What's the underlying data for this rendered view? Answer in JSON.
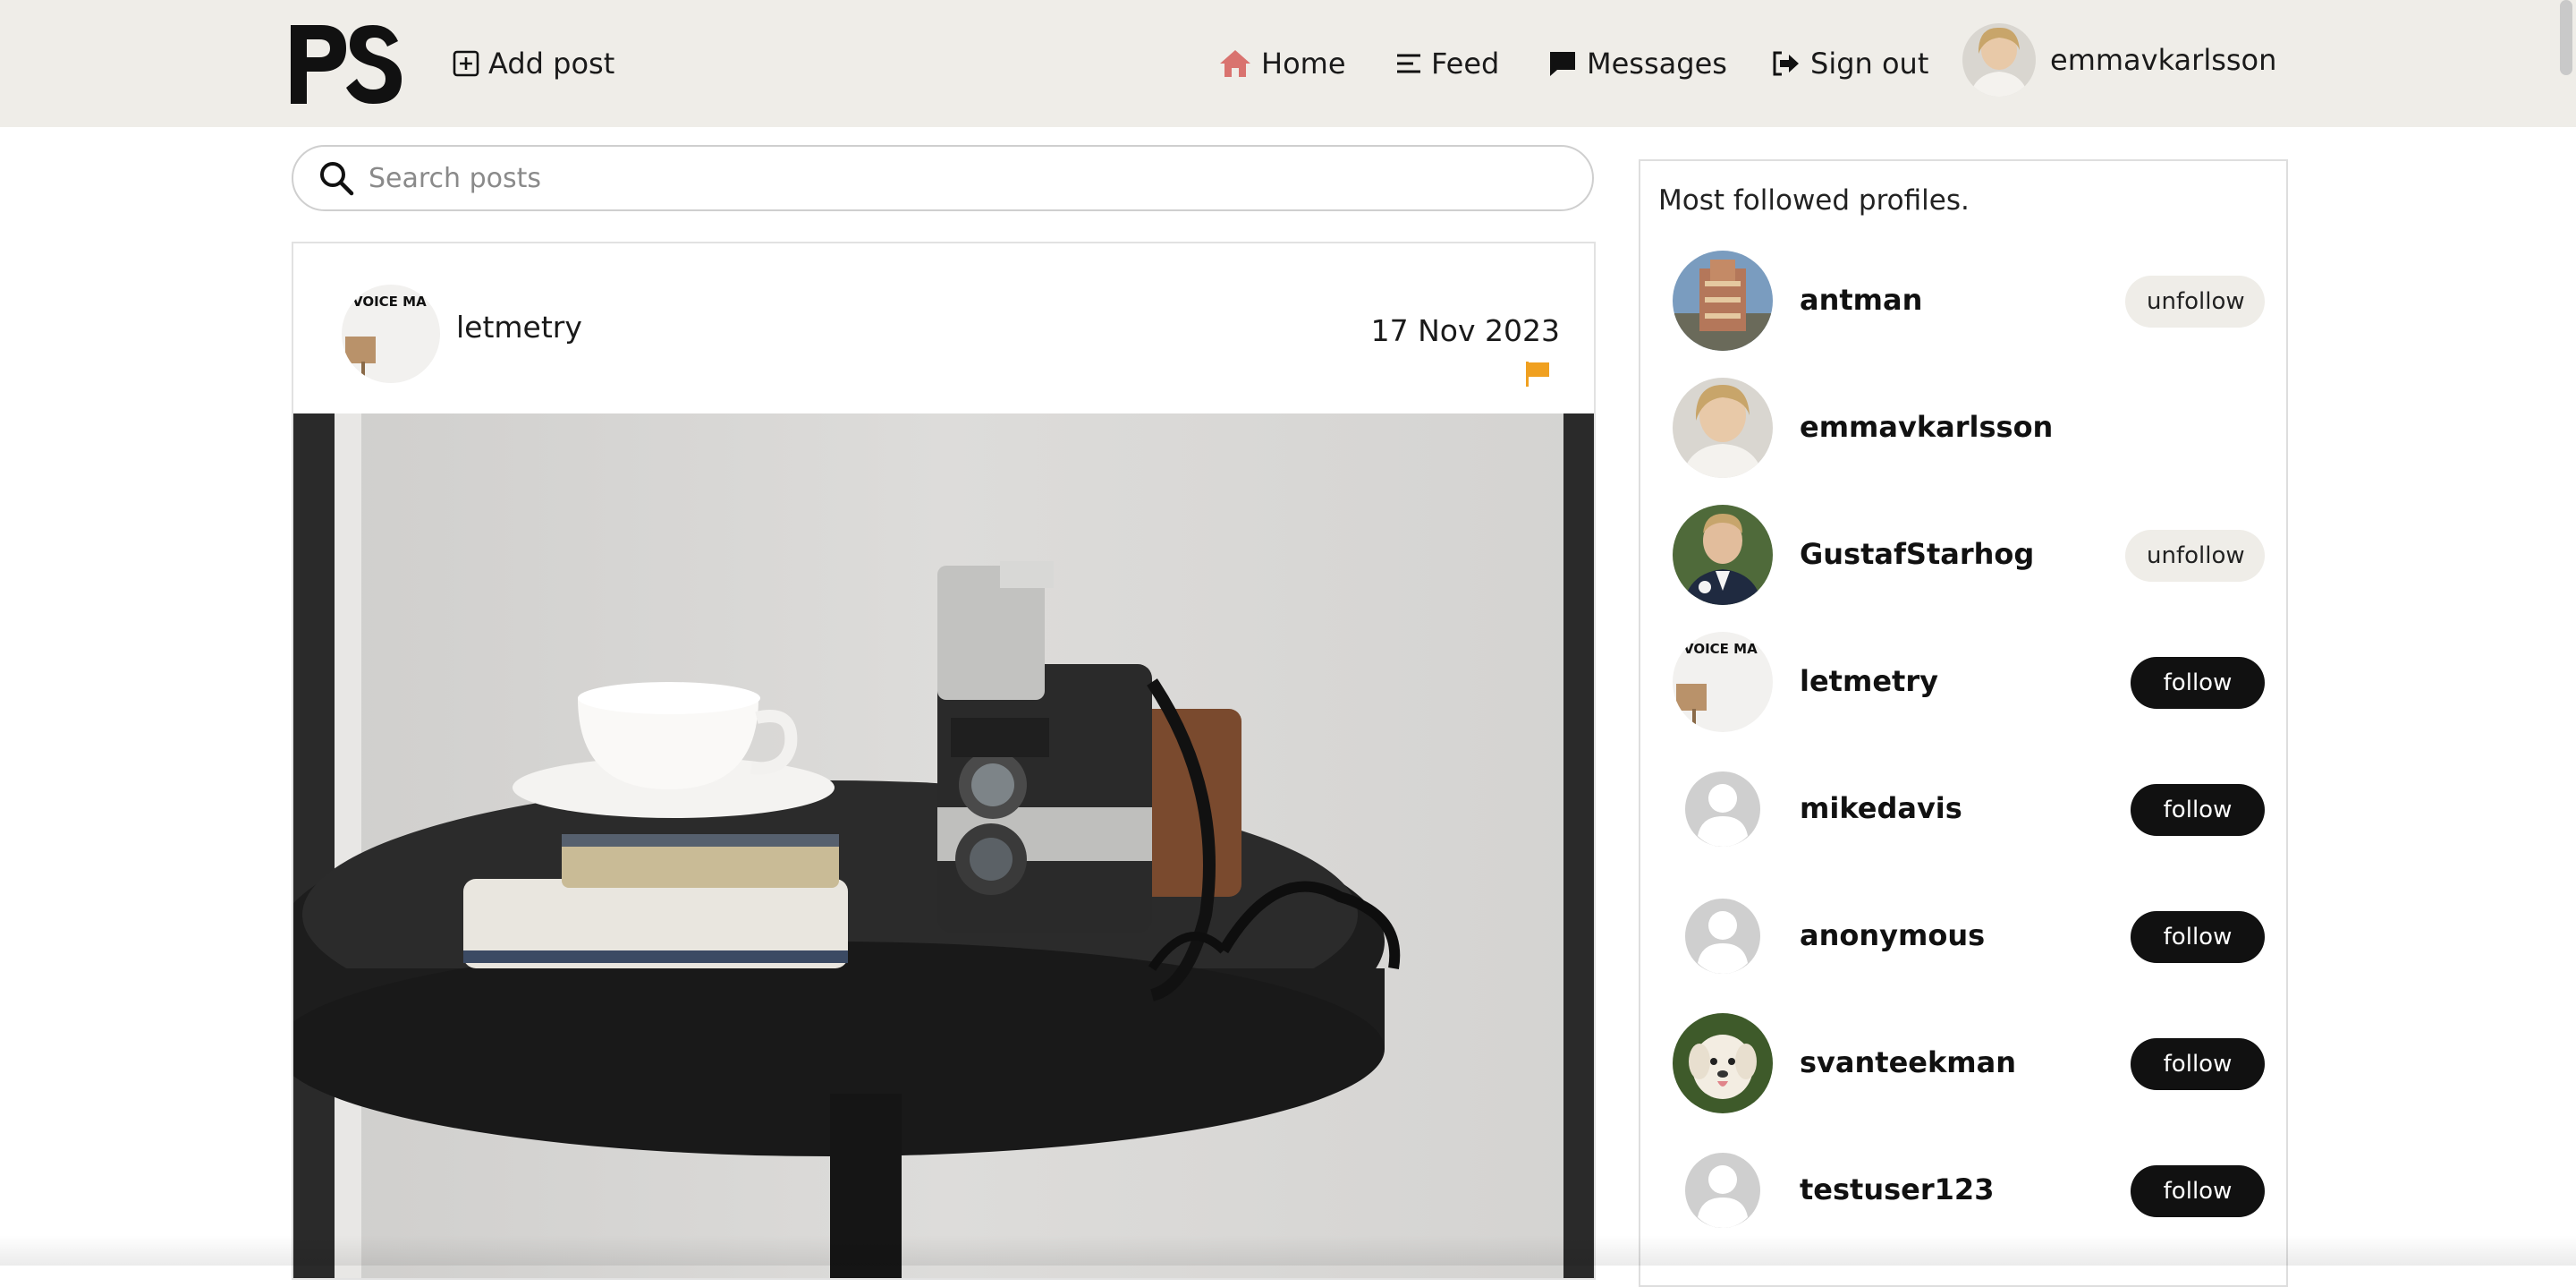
{
  "header": {
    "add_post_label": "Add post",
    "nav": {
      "home": "Home",
      "feed": "Feed",
      "messages": "Messages",
      "sign_out": "Sign out"
    },
    "current_user": "emmavkarlsson"
  },
  "search": {
    "placeholder": "Search posts"
  },
  "post": {
    "author": "letmetry",
    "date": "17 Nov 2023",
    "avatar_text": "VOICE MA"
  },
  "sidebar": {
    "title": "Most followed profiles.",
    "profiles": [
      {
        "name": "antman",
        "action": "unfollow"
      },
      {
        "name": "emmavkarlsson",
        "action": ""
      },
      {
        "name": "GustafStarhog",
        "action": "unfollow"
      },
      {
        "name": "letmetry",
        "action": "follow"
      },
      {
        "name": "mikedavis",
        "action": "follow"
      },
      {
        "name": "anonymous",
        "action": "follow"
      },
      {
        "name": "svanteekman",
        "action": "follow"
      },
      {
        "name": "testuser123",
        "action": "follow"
      }
    ]
  },
  "colors": {
    "navbar_bg": "#efede8",
    "home_icon": "#d9736f",
    "flag_icon": "#f0a020",
    "follow_bg": "#111111",
    "unfollow_bg": "#efede8"
  }
}
